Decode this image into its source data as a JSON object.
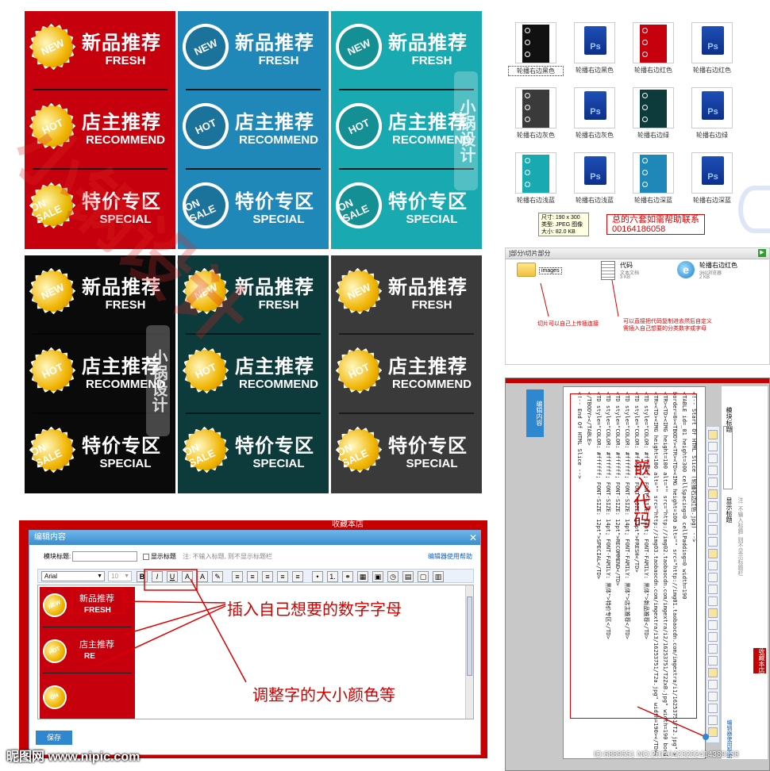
{
  "banners": [
    {
      "bg": "#c6000c",
      "badge_style": "star",
      "divider": "dark"
    },
    {
      "bg": "#2088b8",
      "badge_style": "circle",
      "divider": "dark"
    },
    {
      "bg": "#18aab0",
      "badge_style": "circle",
      "divider": "dark"
    },
    {
      "bg": "#0a0a0a",
      "badge_style": "star",
      "divider": "light"
    },
    {
      "bg": "#0d3a3a",
      "badge_style": "star",
      "divider": "light"
    },
    {
      "bg": "#3a3a3a",
      "badge_style": "star",
      "divider": "light"
    }
  ],
  "banner_rows": [
    {
      "badge": "NEW",
      "cn": "新品推荐",
      "en": "FRESH"
    },
    {
      "badge": "HOT",
      "cn": "店主推荐",
      "en": "RECOMMEND"
    },
    {
      "badge": "ON SALE",
      "cn": "特价专区",
      "en": "SPECIAL"
    }
  ],
  "watermark_vertical": "小锅设计",
  "files": [
    {
      "name": "轮播右边黑色",
      "kind": "thumb",
      "color": "#111111"
    },
    {
      "name": "轮播右边黑色",
      "kind": "psd",
      "color": "#1e4fb5"
    },
    {
      "name": "轮播右边红色",
      "kind": "thumb",
      "color": "#c6000c"
    },
    {
      "name": "轮播右边红色",
      "kind": "psd",
      "color": "#1e4fb5"
    },
    {
      "name": "轮播右边灰色",
      "kind": "thumb",
      "color": "#3a3a3a"
    },
    {
      "name": "轮播右边灰色",
      "kind": "psd",
      "color": "#1e4fb5"
    },
    {
      "name": "轮播右边绿",
      "kind": "thumb",
      "color": "#0d3a3a"
    },
    {
      "name": "轮播右边绿",
      "kind": "psd",
      "color": "#1e4fb5"
    },
    {
      "name": "轮播右边浅蓝",
      "kind": "thumb",
      "color": "#18aab0"
    },
    {
      "name": "轮播右边浅蓝",
      "kind": "psd",
      "color": "#1e4fb5"
    },
    {
      "name": "轮播右边深蓝",
      "kind": "thumb",
      "color": "#2088b8"
    },
    {
      "name": "轮播右边深蓝",
      "kind": "psd",
      "color": "#1e4fb5"
    }
  ],
  "file_tooltip": {
    "size": "尺寸: 190 x 300",
    "type": "类型: JPEG 图像",
    "filesize": "大小: 82.0 KB"
  },
  "help_note": {
    "line1": "总的六套如需帮助联系",
    "line2": "00164186058"
  },
  "explorer": {
    "path": "]部分\\切片部分",
    "items": [
      {
        "name": "images",
        "sub": "",
        "icon": "folder-icon"
      },
      {
        "name": "代码",
        "sub": "文本文档",
        "sub2": "3 KB",
        "icon": "text-file-icon"
      },
      {
        "name": "轮播右边红色",
        "sub": "360浏览器",
        "sub2": "2 KB",
        "icon": "browser-icon"
      }
    ],
    "note_left": "切片可以自己上传插连接",
    "note_right": "可以直接把代码复制进去然后自定义需插入自己想要的分类数字或字母"
  },
  "editor": {
    "title": "编辑内容",
    "close_icon": "close-icon",
    "block_title_label": "模块标题:",
    "block_title_value": "",
    "show_title_label": "显示标题",
    "hint": "注: 不输入标题, 则不显示标题栏",
    "help_link": "编辑器使用帮助",
    "font_value": "Arial",
    "size_value": "10",
    "tool_buttons": [
      "B",
      "I",
      "U",
      "A",
      "A",
      "✎",
      "≡",
      "≡",
      "≡",
      "≡",
      "≡",
      "•",
      "1.",
      "⚭",
      "▦",
      "▣",
      "◷",
      "▤",
      "▢",
      "▥"
    ],
    "content_rows": [
      {
        "badge": "NEW",
        "cn": "新品推荐",
        "en": "FRESH"
      },
      {
        "badge": "HOT",
        "cn": "店主推荐",
        "en": "RE"
      },
      {
        "badge": "ON",
        "cn": "",
        "en": ""
      }
    ],
    "save_label": "保存",
    "shop_link": "收藏本店"
  },
  "annotations": {
    "insert_text": "插入自己想要的数字字母",
    "adjust_text": "调整字的大小颜色等",
    "embed_text": "嵌入代码"
  },
  "codewin": {
    "side_title": "编辑内容",
    "side_label1": "模块标题",
    "side_label2": "显示标题",
    "side_hint": "注: 不输入标题, 则不显示标题栏",
    "side_button": "收藏本店",
    "side_links": "编辑器使用帮助",
    "code_lines": [
      "<!-- Start Of HTML Slice (轮播右边红色.jpg) -->",
      "<TABLE id=_01 height=300 cellSpacing=0 cellPadding=0 width=190",
      "border=0><TBODY><TR><TD><IMG height=100 alt=\"\" src=\"http://img01.taobaocdn.com/imgextra/i1/16253751/T2.jpg\" width=190></TD></TR>",
      "<TR><TD><IMG height=100 alt=\"\" src=\"http://img02.taobaocdn.com/imgextra/i2/16253751/T2ZxB.jpg\" width=190 border=0></TD></TR>",
      "<TR><TD><IMG height=100 alt=\"\" src=\"http://img03.taobaocdn.com/imgextra/i3/16253751/T2a.jpg\" width=190></TD></TR>",
      "<TD style=\"COLOR: #ffffff; FONT-SIZE: 14pt; FONT-FAMILY: 黑体\">新品推荐</TD>",
      "<TD style=\"COLOR: #ffffff; FONT-SIZE: 12pt\">FRESH</TD>",
      "<TD style=\"COLOR: #ffffff; FONT-SIZE: 14pt; FONT-FAMILY: 黑体\">店主推荐</TD>",
      "<TD style=\"COLOR: #ffffff; FONT-SIZE: 12pt\">RECOMMEND</TD>",
      "<TD style=\"COLOR: #ffffff; FONT-SIZE: 14pt; FONT-FAMILY: 黑体\">特价专区</TD>",
      "<TD style=\"COLOR: #ffffff; FONT-SIZE: 12pt\">SPECIAL</TD>",
      "</TBODY></TABLE>",
      "<!-- End Of HTML Slice -->"
    ]
  },
  "footer": {
    "site": "昵图网 www.nipic.com",
    "id": "ID:6889551 NO:20110423202414389138"
  }
}
